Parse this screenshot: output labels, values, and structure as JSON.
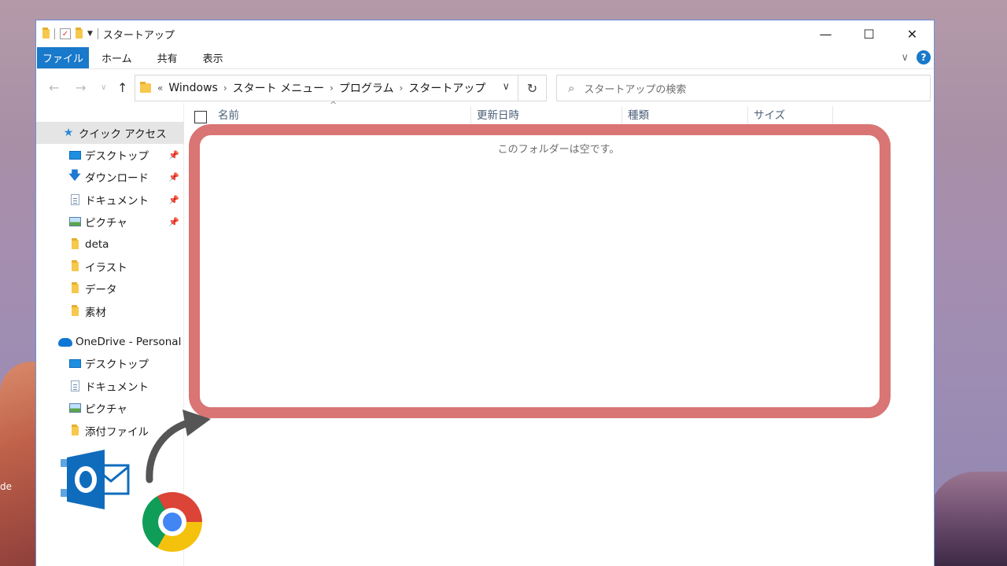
{
  "window": {
    "title": "スタートアップ",
    "controls": {
      "minimize": "—",
      "maximize": "☐",
      "close": "✕"
    }
  },
  "ribbon": {
    "tabs": [
      {
        "label": "ファイル",
        "active": true
      },
      {
        "label": "ホーム",
        "active": false
      },
      {
        "label": "共有",
        "active": false
      },
      {
        "label": "表示",
        "active": false
      }
    ],
    "help_label": "?"
  },
  "address_bar": {
    "overflow": "«",
    "crumbs": [
      "Windows",
      "スタート メニュー",
      "プログラム",
      "スタートアップ"
    ],
    "search_placeholder": "スタートアップの検索"
  },
  "nav_pane": {
    "quick_access": {
      "label": "クイック アクセス",
      "items": [
        {
          "label": "デスクトップ",
          "icon": "desktop-icon",
          "pinned": true
        },
        {
          "label": "ダウンロード",
          "icon": "download-icon",
          "pinned": true
        },
        {
          "label": "ドキュメント",
          "icon": "document-icon",
          "pinned": true
        },
        {
          "label": "ピクチャ",
          "icon": "picture-icon",
          "pinned": true
        },
        {
          "label": "deta",
          "icon": "folder-icon",
          "pinned": false
        },
        {
          "label": "イラスト",
          "icon": "folder-icon",
          "pinned": false
        },
        {
          "label": "データ",
          "icon": "folder-icon",
          "pinned": false
        },
        {
          "label": "素材",
          "icon": "folder-icon",
          "pinned": false
        }
      ]
    },
    "onedrive": {
      "label": "OneDrive - Personal",
      "items": [
        {
          "label": "デスクトップ",
          "icon": "desktop-icon"
        },
        {
          "label": "ドキュメント",
          "icon": "document-icon"
        },
        {
          "label": "ピクチャ",
          "icon": "picture-icon"
        },
        {
          "label": "添付ファイル",
          "icon": "folder-icon"
        }
      ]
    }
  },
  "content": {
    "columns": [
      "名前",
      "更新日時",
      "種類",
      "サイズ"
    ],
    "empty_message": "このフォルダーは空です。"
  },
  "desktop": {
    "partial_label": "de"
  },
  "colors": {
    "accent": "#1979ca",
    "highlight_border": "#d97574",
    "folder": "#f6c84c",
    "outlook_blue": "#0f6cbd"
  }
}
